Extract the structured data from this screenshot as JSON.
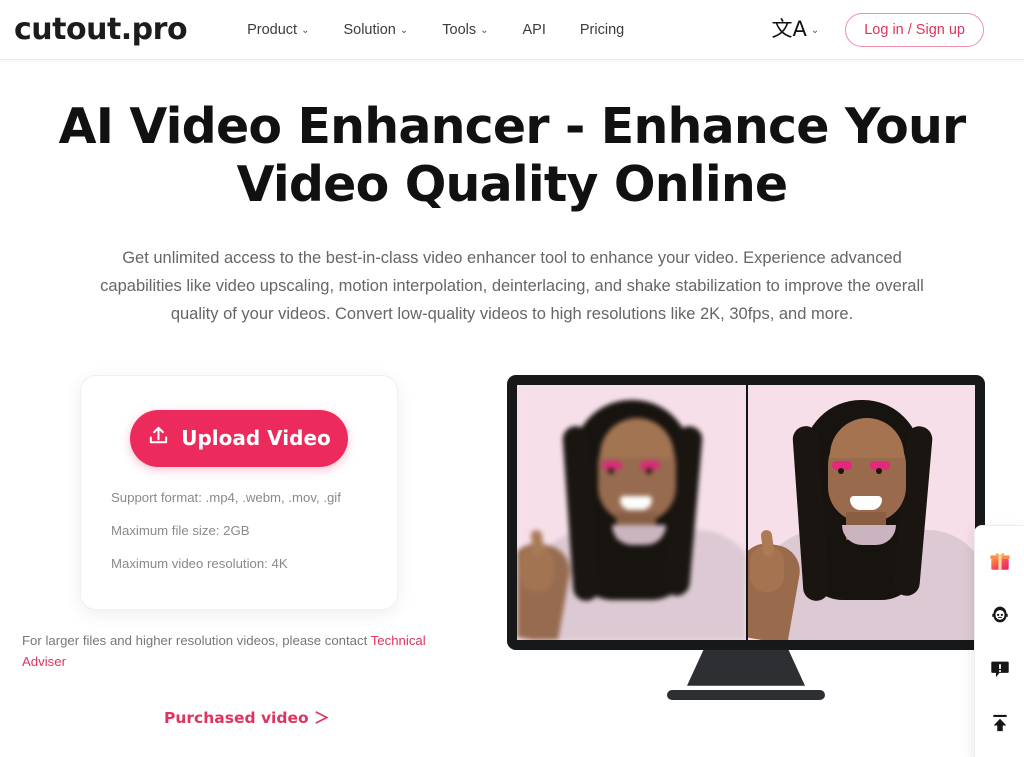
{
  "header": {
    "logo": "cutout.pro",
    "nav": [
      {
        "label": "Product",
        "has_dropdown": true,
        "caret": "⌄"
      },
      {
        "label": "Solution",
        "has_dropdown": true,
        "caret": "⌄"
      },
      {
        "label": "Tools",
        "has_dropdown": true,
        "caret": "⌄"
      },
      {
        "label": "API",
        "has_dropdown": false,
        "caret": ""
      },
      {
        "label": "Pricing",
        "has_dropdown": false,
        "caret": ""
      }
    ],
    "language": {
      "icon": "translate-icon",
      "glyph": "文A",
      "caret": "⌄"
    },
    "login_label": "Log in / Sign up"
  },
  "hero": {
    "title": "AI Video Enhancer - Enhance Your Video Quality Online",
    "subtitle": "Get unlimited access to the best-in-class video enhancer tool to enhance your video. Experience advanced capabilities like video upscaling, motion interpolation, deinterlacing, and shake stabilization to improve the overall quality of your videos. Convert low-quality videos to high resolutions like 2K, 30fps, and more."
  },
  "upload": {
    "button_label": "Upload Video",
    "button_icon": "upload-icon",
    "notes": [
      "Support format: .mp4, .webm, .mov, .gif",
      "Maximum file size: 2GB",
      "Maximum video resolution: 4K"
    ]
  },
  "contact": {
    "prefix": "For larger files and higher resolution videos, please contact ",
    "link_label": "Technical Adviser"
  },
  "purchased": {
    "label": "Purchased video ＞"
  },
  "preview": {
    "alt": "Monitor showing before and after video enhancement comparison",
    "left_pane_label": "before-blurry",
    "right_pane_label": "after-enhanced"
  },
  "float_bar": {
    "items": [
      {
        "name": "gift-icon",
        "title": "Gifts"
      },
      {
        "name": "support-face-icon",
        "title": "Customer Support"
      },
      {
        "name": "feedback-icon",
        "title": "Feedback"
      },
      {
        "name": "scroll-to-top-icon",
        "title": "Back to top"
      }
    ]
  },
  "colors": {
    "accent_pink": "#ED2A5C",
    "link_pink": "#E0335E",
    "border_pink": "#ED8FA8",
    "text_dark": "#111111",
    "text_muted": "#666666",
    "note_gray": "#8A8A8A",
    "monitor_dark": "#17181A",
    "wall_pink": "#F7DFE9"
  }
}
